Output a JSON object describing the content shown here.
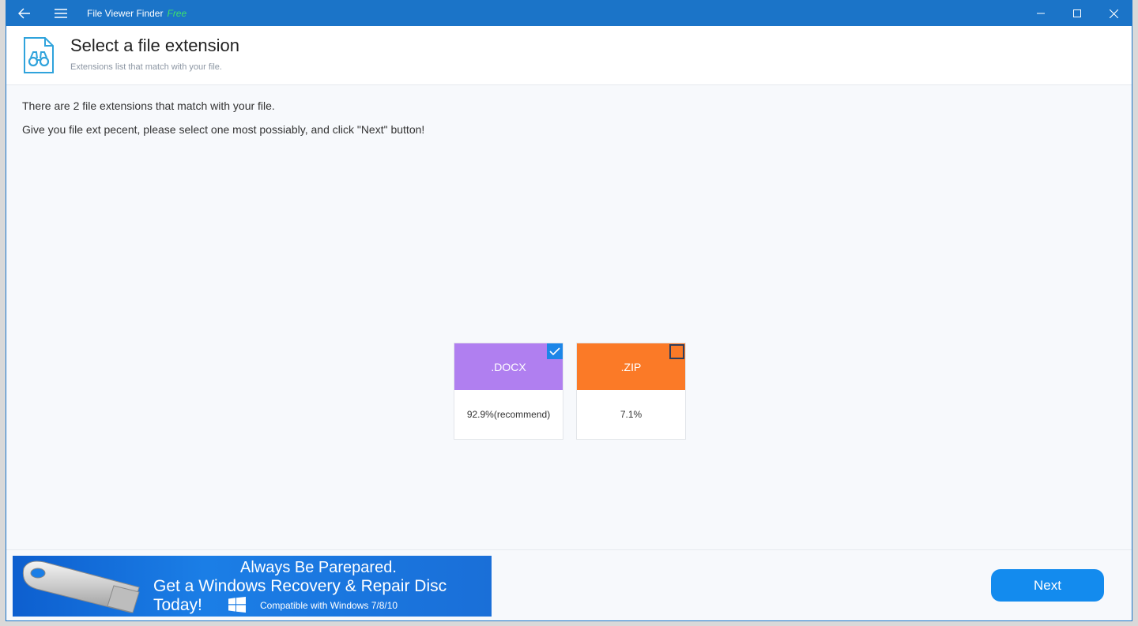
{
  "titlebar": {
    "app_name": "File Viewer Finder",
    "badge": "Free",
    "color": "#1b74c8"
  },
  "header": {
    "title": "Select a file extension",
    "subtitle": "Extensions list that match with your file.",
    "icon": "binoculars-file-icon"
  },
  "body": {
    "line1": "There are 2 file extensions that match with your file.",
    "line2": "Give you file ext pecent, please select one most possiably, and click \"Next\" button!"
  },
  "extensions": [
    {
      "label": ".DOCX",
      "percent_text": "92.9%(recommend)",
      "percent": 92.9,
      "color": "#b07ff0",
      "selected": true
    },
    {
      "label": ".ZIP",
      "percent_text": "7.1%",
      "percent": 7.1,
      "color": "#fb7a27",
      "selected": false
    }
  ],
  "banner": {
    "line1": "Always Be Parepared.",
    "line2": "Get a Windows Recovery & Repair Disc Today!",
    "line3": "Compatible with Windows 7/8/10"
  },
  "footer": {
    "next_label": "Next",
    "accent": "#138bee"
  }
}
